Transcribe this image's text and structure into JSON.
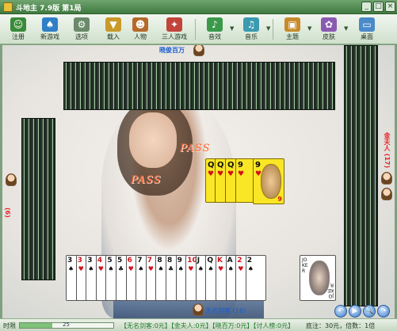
{
  "window": {
    "title": "斗地主 7.9版 第1局",
    "buttons": [
      "_",
      "□",
      "×"
    ]
  },
  "toolbar": {
    "items": [
      {
        "label": "注册",
        "icon": "register-icon",
        "color": "#3a8a3a"
      },
      {
        "label": "新游戏",
        "icon": "new-game-icon",
        "color": "#2f7fc8"
      },
      {
        "label": "选项",
        "icon": "options-gear-icon",
        "color": "#6a8a6a"
      },
      {
        "label": "载入",
        "icon": "load-icon",
        "color": "#c89a2a"
      },
      {
        "label": "人物",
        "icon": "characters-icon",
        "color": "#b56a2a"
      },
      {
        "label": "三人游戏",
        "icon": "three-player-icon",
        "color": "#c2443a"
      },
      {
        "label": "音效",
        "icon": "sound-icon",
        "color": "#3a9a4a"
      },
      {
        "label": "音乐",
        "icon": "music-icon",
        "color": "#3a9ab0"
      },
      {
        "label": "主题",
        "icon": "theme-icon",
        "color": "#c88a2a"
      },
      {
        "label": "皮肤",
        "icon": "skin-icon",
        "color": "#8a5ab0"
      },
      {
        "label": "桌面",
        "icon": "desktop-icon",
        "color": "#4a8ac8"
      }
    ]
  },
  "players": {
    "top": {
      "name": "晓俊百万"
    },
    "left": {
      "name": "(6)"
    },
    "right": {
      "name": "金夫人 (17)"
    },
    "bottom": {
      "name": "无名剑客 (16)"
    }
  },
  "pass_text": [
    "PASS",
    "PASS"
  ],
  "played_cards": [
    {
      "rank": "Q",
      "suit": "♥"
    },
    {
      "rank": "Q",
      "suit": "♥"
    },
    {
      "rank": "Q",
      "suit": "♥"
    },
    {
      "rank": "9",
      "suit": "♥"
    },
    {
      "rank": "9",
      "suit": "♥"
    }
  ],
  "hand_cards": [
    {
      "rank": "3",
      "suit": "♠",
      "color": "blk"
    },
    {
      "rank": "3",
      "suit": "♥",
      "color": "red"
    },
    {
      "rank": "3",
      "suit": "♠",
      "color": "blk"
    },
    {
      "rank": "4",
      "suit": "♥",
      "color": "red"
    },
    {
      "rank": "5",
      "suit": "♠",
      "color": "blk"
    },
    {
      "rank": "5",
      "suit": "♣",
      "color": "blk"
    },
    {
      "rank": "6",
      "suit": "♥",
      "color": "red"
    },
    {
      "rank": "7",
      "suit": "♠",
      "color": "blk"
    },
    {
      "rank": "7",
      "suit": "♥",
      "color": "red"
    },
    {
      "rank": "8",
      "suit": "♠",
      "color": "blk"
    },
    {
      "rank": "8",
      "suit": "♣",
      "color": "blk"
    },
    {
      "rank": "9",
      "suit": "♠",
      "color": "blk"
    },
    {
      "rank": "10",
      "suit": "♥",
      "color": "red"
    },
    {
      "rank": "J",
      "suit": "♠",
      "color": "blk"
    },
    {
      "rank": "Q",
      "suit": "♠",
      "color": "blk"
    },
    {
      "rank": "K",
      "suit": "♥",
      "color": "red"
    },
    {
      "rank": "A",
      "suit": "♠",
      "color": "blk"
    },
    {
      "rank": "2",
      "suit": "♥",
      "color": "red"
    },
    {
      "rank": "2",
      "suit": "♠",
      "color": "blk"
    }
  ],
  "joker": {
    "top": "JOKER",
    "bottom": "JOKER"
  },
  "status": {
    "time_label": "时限",
    "timer_value": "25",
    "timer_fraction": 0.35,
    "scores": "【无名剑客:0元】【金夫人:0元】【晓百万:0元】【讨人榜:0元】",
    "stake": "底注：30元，倍数：1倍"
  },
  "controls": [
    "↶",
    "▶",
    "🔍",
    "↷"
  ]
}
